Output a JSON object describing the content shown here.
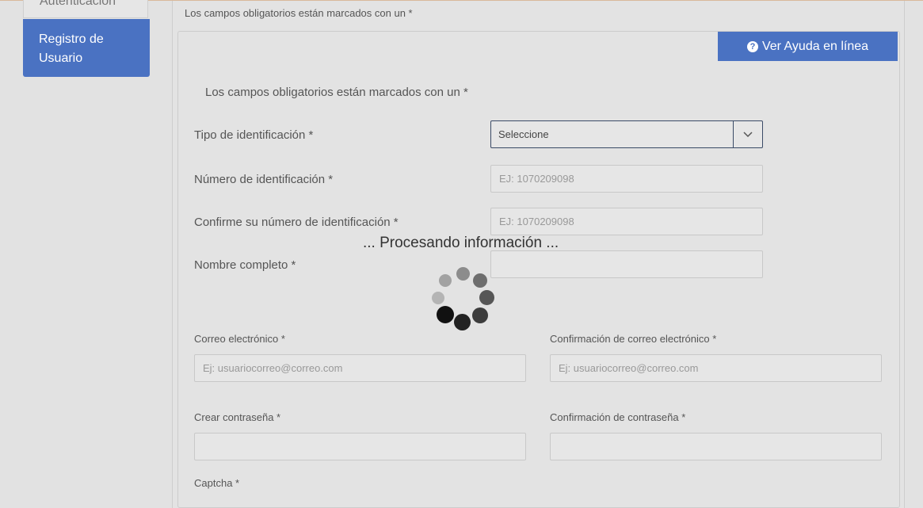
{
  "sidebar": {
    "prev_item": "Autenticación",
    "active_item": "Registro de Usuario"
  },
  "header": {
    "required_note": "Los campos obligatorios están marcados con un *"
  },
  "help_button": {
    "icon": "question-circle-icon",
    "label": "Ver Ayuda en línea"
  },
  "form": {
    "required_note": "Los campos obligatorios están marcados con un *",
    "id_type_label": "Tipo de identificación *",
    "id_type_value": "Seleccione",
    "id_number_label": "Número de identificación *",
    "id_number_placeholder": "EJ: 1070209098",
    "confirm_id_label": "Confirme su número de identificación *",
    "confirm_id_placeholder": "EJ: 1070209098",
    "full_name_label": "Nombre completo *",
    "full_name_placeholder": "",
    "email_label": "Correo electrónico *",
    "email_placeholder": "Ej: usuariocorreo@correo.com",
    "confirm_email_label": "Confirmación de correo electrónico *",
    "confirm_email_placeholder": "Ej: usuariocorreo@correo.com",
    "password_label": "Crear contraseña *",
    "confirm_password_label": "Confirmación de contraseña *",
    "captcha_label": "Captcha *"
  },
  "loader": {
    "text": "... Procesando información ..."
  },
  "colors": {
    "accent": "#4a72c2",
    "background": "#e2e2e2"
  }
}
